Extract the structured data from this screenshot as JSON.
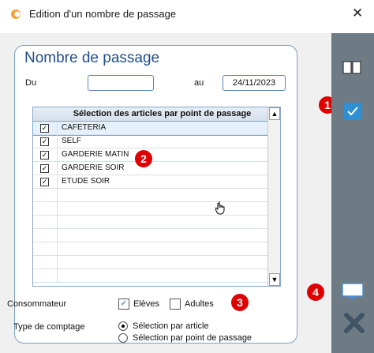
{
  "window": {
    "title": "Edition d'un nombre de passage",
    "close_glyph": "✕"
  },
  "panel": {
    "title": "Nombre de passage",
    "du_label": "Du",
    "du_value": "",
    "au_label": "au",
    "au_value": "24/11/2023"
  },
  "table": {
    "header": "Sélection des articles par point de passage",
    "rows": [
      {
        "label": "CAFETERIA",
        "checked": true,
        "selected": true
      },
      {
        "label": "SELF",
        "checked": true
      },
      {
        "label": "GARDERIE MATIN",
        "checked": true
      },
      {
        "label": "GARDERIE SOIR",
        "checked": true
      },
      {
        "label": "ETUDE SOIR",
        "checked": true
      }
    ],
    "check_glyph": "✓"
  },
  "consommateur": {
    "label": "Consommateur",
    "eleves_label": "Elèves",
    "eleves_checked": true,
    "adultes_label": "Adultes",
    "adultes_checked": false
  },
  "comptage": {
    "label": "Type de comptage",
    "options": [
      "Sélection par article",
      "Sélection par point de passage"
    ],
    "selected_index": 0
  },
  "badges": [
    "1",
    "2",
    "3",
    "4"
  ],
  "toolbar": {
    "icons": [
      "book-icon",
      "check-icon",
      "monitor-icon",
      "delete-icon"
    ]
  },
  "colors": {
    "accent": "#1f4e8c",
    "badge": "#e00000",
    "toolbar_bg": "#6e7b85"
  }
}
